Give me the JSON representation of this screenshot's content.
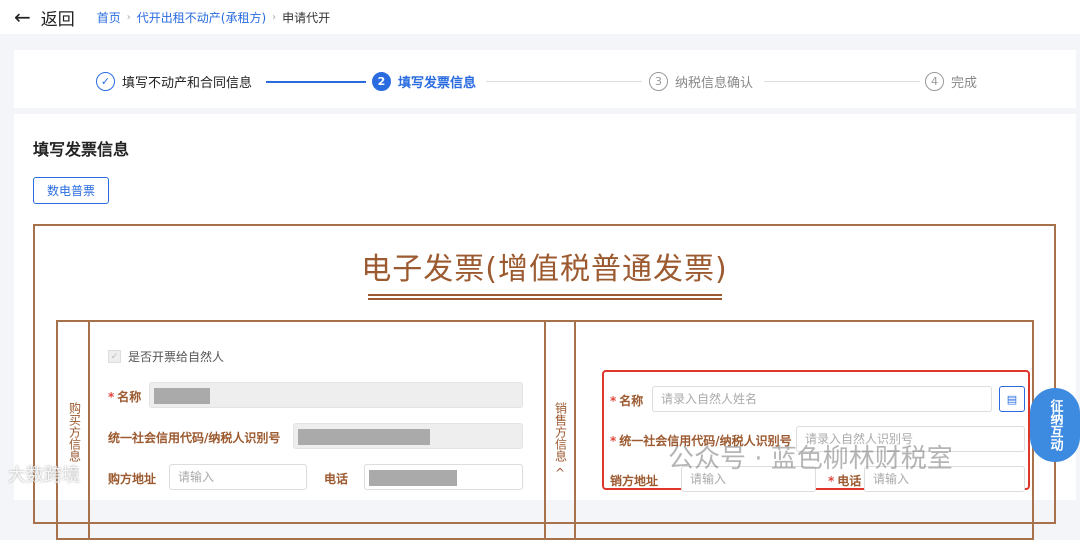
{
  "header": {
    "back_label": "返回",
    "breadcrumb": [
      "首页",
      "代开出租不动产(承租方)",
      "申请代开"
    ]
  },
  "steps": [
    {
      "num": "1",
      "label": "填写不动产和合同信息",
      "state": "done"
    },
    {
      "num": "2",
      "label": "填写发票信息",
      "state": "active"
    },
    {
      "num": "3",
      "label": "纳税信息确认",
      "state": "pending"
    },
    {
      "num": "4",
      "label": "完成",
      "state": "pending"
    }
  ],
  "section_title": "填写发票信息",
  "invoice_type_button": "数电普票",
  "invoice": {
    "title": "电子发票(增值税普通发票)",
    "buyer": {
      "side_label": "购买方信息",
      "collapse": "^",
      "natural_person_checkbox": "是否开票给自然人",
      "name_label": "名称",
      "tax_id_label": "统一社会信用代码/纳税人识别号",
      "address_label": "购方地址",
      "address_placeholder": "请输入",
      "phone_label": "电话"
    },
    "seller": {
      "side_label": "销售方信息",
      "collapse": "^",
      "name_label": "名称",
      "name_placeholder": "请录入自然人姓名",
      "tax_id_label": "统一社会信用代码/纳税人识别号",
      "tax_id_placeholder": "请录入自然人识别号",
      "address_label": "销方地址",
      "address_placeholder": "请输入",
      "phone_label": "电话",
      "phone_placeholder": "请输入"
    }
  },
  "float_widget": "征纳互动",
  "watermarks": [
    "公众号 · 蓝色柳林财税室",
    "大数跨境"
  ],
  "colors": {
    "accent": "#2a6ce0",
    "invoice_brown": "#9c5a30",
    "highlight": "#e0352b"
  }
}
